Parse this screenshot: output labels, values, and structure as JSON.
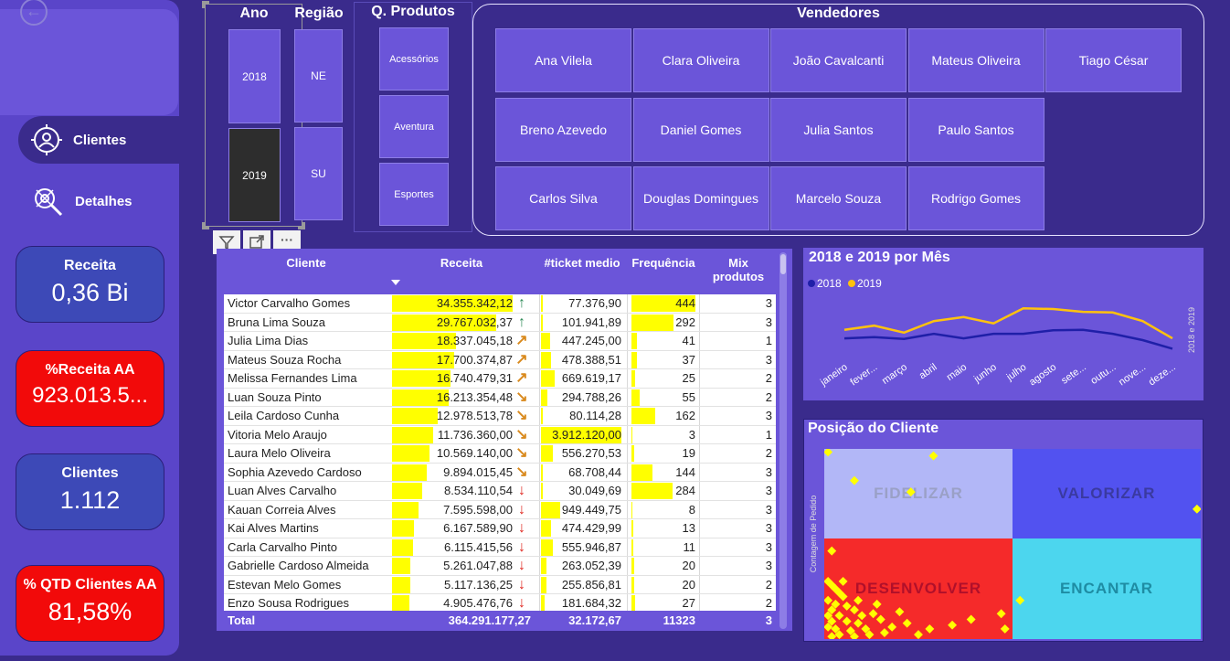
{
  "sidebar": {
    "back_icon": "back-arrow-icon",
    "nav": [
      {
        "label": "Clientes",
        "icon": "client-target-icon"
      },
      {
        "label": "Detalhes",
        "icon": "magnifier-target-icon"
      }
    ],
    "kpis": [
      {
        "title": "Receita",
        "value": "0,36 Bi"
      },
      {
        "title": "%Receita AA",
        "value": "923.013.5..."
      },
      {
        "title": "Clientes",
        "value": "1.112"
      },
      {
        "title": "% QTD Clientes AA",
        "value": "81,58%"
      }
    ]
  },
  "slicers": {
    "ano": {
      "title": "Ano",
      "options": [
        "2018",
        "2019"
      ],
      "selected": "2019"
    },
    "regiao": {
      "title": "Região",
      "options": [
        "NE",
        "SU"
      ]
    },
    "qprodutos": {
      "title": "Q. Produtos",
      "options": [
        "Acessórios",
        "Aventura",
        "Esportes"
      ]
    },
    "vendedores": {
      "title": "Vendedores",
      "options": [
        "Ana Vilela",
        "Clara Oliveira",
        "João Cavalcanti",
        "Mateus Oliveira",
        "Tiago César",
        "Breno Azevedo",
        "Daniel Gomes",
        "Julia Santos",
        "Paulo Santos",
        "Carlos Silva",
        "Douglas Domingues",
        "Marcelo Souza",
        "Rodrigo Gomes"
      ]
    }
  },
  "visual_icons": [
    "filter-icon",
    "focus-mode-icon",
    "more-options-icon"
  ],
  "table": {
    "headers": {
      "cliente": "Cliente",
      "receita": "Receita",
      "ticket": "#ticket medio",
      "freq": "Frequência",
      "mix": "Mix produtos"
    },
    "rows": [
      {
        "cliente": "Victor Carvalho Gomes",
        "receita": "34.355.342,12",
        "r": 34355342,
        "trend": "up",
        "ticket": "77.376,90",
        "t": 77377,
        "freq": "444",
        "f": 444,
        "mix": "3"
      },
      {
        "cliente": "Bruna Lima Souza",
        "receita": "29.767.032,37",
        "r": 29767032,
        "trend": "up",
        "ticket": "101.941,89",
        "t": 101942,
        "freq": "292",
        "f": 292,
        "mix": "3"
      },
      {
        "cliente": "Julia Lima Dias",
        "receita": "18.337.045,18",
        "r": 18337045,
        "trend": "diag-up",
        "ticket": "447.245,00",
        "t": 447245,
        "freq": "41",
        "f": 41,
        "mix": "1"
      },
      {
        "cliente": "Mateus Souza Rocha",
        "receita": "17.700.374,87",
        "r": 17700375,
        "trend": "diag-up",
        "ticket": "478.388,51",
        "t": 478389,
        "freq": "37",
        "f": 37,
        "mix": "3"
      },
      {
        "cliente": "Melissa Fernandes Lima",
        "receita": "16.740.479,31",
        "r": 16740479,
        "trend": "diag-up",
        "ticket": "669.619,17",
        "t": 669619,
        "freq": "25",
        "f": 25,
        "mix": "2"
      },
      {
        "cliente": "Luan Souza Pinto",
        "receita": "16.213.354,48",
        "r": 16213354,
        "trend": "diag-down",
        "ticket": "294.788,26",
        "t": 294788,
        "freq": "55",
        "f": 55,
        "mix": "2"
      },
      {
        "cliente": "Leila Cardoso Cunha",
        "receita": "12.978.513,78",
        "r": 12978514,
        "trend": "diag-down",
        "ticket": "80.114,28",
        "t": 80114,
        "freq": "162",
        "f": 162,
        "mix": "3"
      },
      {
        "cliente": "Vitoria Melo Araujo",
        "receita": "11.736.360,00",
        "r": 11736360,
        "trend": "diag-down",
        "ticket": "3.912.120,00",
        "t": 3912120,
        "freq": "3",
        "f": 3,
        "mix": "1"
      },
      {
        "cliente": "Laura Melo Oliveira",
        "receita": "10.569.140,00",
        "r": 10569140,
        "trend": "diag-down",
        "ticket": "556.270,53",
        "t": 556271,
        "freq": "19",
        "f": 19,
        "mix": "2"
      },
      {
        "cliente": "Sophia Azevedo Cardoso",
        "receita": "9.894.015,45",
        "r": 9894015,
        "trend": "diag-down",
        "ticket": "68.708,44",
        "t": 68708,
        "freq": "144",
        "f": 144,
        "mix": "3"
      },
      {
        "cliente": "Luan Alves Carvalho",
        "receita": "8.534.110,54",
        "r": 8534111,
        "trend": "down",
        "ticket": "30.049,69",
        "t": 30050,
        "freq": "284",
        "f": 284,
        "mix": "3"
      },
      {
        "cliente": "Kauan Correia Alves",
        "receita": "7.595.598,00",
        "r": 7595598,
        "trend": "down",
        "ticket": "949.449,75",
        "t": 949450,
        "freq": "8",
        "f": 8,
        "mix": "3"
      },
      {
        "cliente": "Kai Alves Martins",
        "receita": "6.167.589,90",
        "r": 6167590,
        "trend": "down",
        "ticket": "474.429,99",
        "t": 474430,
        "freq": "13",
        "f": 13,
        "mix": "3"
      },
      {
        "cliente": "Carla Carvalho Pinto",
        "receita": "6.115.415,56",
        "r": 6115416,
        "trend": "down",
        "ticket": "555.946,87",
        "t": 555947,
        "freq": "11",
        "f": 11,
        "mix": "3"
      },
      {
        "cliente": "Gabrielle Cardoso Almeida",
        "receita": "5.261.047,88",
        "r": 5261048,
        "trend": "down",
        "ticket": "263.052,39",
        "t": 263052,
        "freq": "20",
        "f": 20,
        "mix": "3"
      },
      {
        "cliente": "Estevan Melo Gomes",
        "receita": "5.117.136,25",
        "r": 5117136,
        "trend": "down",
        "ticket": "255.856,81",
        "t": 255857,
        "freq": "20",
        "f": 20,
        "mix": "2"
      },
      {
        "cliente": "Enzo Sousa Rodrigues",
        "receita": "4.905.476,76",
        "r": 4905477,
        "trend": "down",
        "ticket": "181.684,32",
        "t": 181684,
        "freq": "27",
        "f": 27,
        "mix": "2"
      }
    ],
    "total": {
      "label": "Total",
      "receita": "364.291.177,27",
      "ticket": "32.172,67",
      "freq": "11323",
      "mix": "3"
    }
  },
  "chart_data": [
    {
      "type": "line",
      "title": "2018 e 2019 por Mês",
      "ylabel": "2018 e 2019",
      "categories": [
        "janeiro",
        "fever...",
        "março",
        "abril",
        "maio",
        "junho",
        "julho",
        "agosto",
        "sete...",
        "outu...",
        "nove...",
        "deze..."
      ],
      "series": [
        {
          "name": "2018",
          "color": "#1f1fa8",
          "values": [
            0.3,
            0.32,
            0.29,
            0.38,
            0.3,
            0.38,
            0.38,
            0.44,
            0.45,
            0.38,
            0.27,
            0.12
          ]
        },
        {
          "name": "2019",
          "color": "#ffc20e",
          "values": [
            0.45,
            0.52,
            0.4,
            0.6,
            0.67,
            0.56,
            0.82,
            0.81,
            0.76,
            0.75,
            0.6,
            0.3
          ]
        }
      ],
      "ylim": [
        0,
        1
      ]
    },
    {
      "type": "scatter",
      "title": "Posição do Cliente",
      "ylabel": "Contagem de Pedido",
      "quadrants": [
        "FIDELIZAR",
        "VALORIZAR",
        "DESENVOLVER",
        "ENCANTAR"
      ],
      "quadrant_colors": [
        "#b2b7f7",
        "#5252f0",
        "#f52a2a",
        "#4cd6ee"
      ],
      "point_color": "#ffff00",
      "points": [
        [
          0.01,
          0.98
        ],
        [
          0.29,
          0.96
        ],
        [
          0.08,
          0.83
        ],
        [
          0.23,
          0.77
        ],
        [
          0.99,
          0.68
        ],
        [
          0.02,
          0.46
        ],
        [
          0.01,
          0.3
        ],
        [
          0.02,
          0.28
        ],
        [
          0.03,
          0.26
        ],
        [
          0.04,
          0.24
        ],
        [
          0.05,
          0.22
        ],
        [
          0.01,
          0.2
        ],
        [
          0.03,
          0.18
        ],
        [
          0.06,
          0.17
        ],
        [
          0.02,
          0.15
        ],
        [
          0.08,
          0.15
        ],
        [
          0.01,
          0.12
        ],
        [
          0.04,
          0.12
        ],
        [
          0.1,
          0.12
        ],
        [
          0.13,
          0.13
        ],
        [
          0.02,
          0.09
        ],
        [
          0.06,
          0.09
        ],
        [
          0.09,
          0.08
        ],
        [
          0.15,
          0.1
        ],
        [
          0.01,
          0.06
        ],
        [
          0.03,
          0.05
        ],
        [
          0.07,
          0.04
        ],
        [
          0.11,
          0.05
        ],
        [
          0.18,
          0.06
        ],
        [
          0.22,
          0.08
        ],
        [
          0.04,
          0.02
        ],
        [
          0.12,
          0.02
        ],
        [
          0.16,
          0.03
        ],
        [
          0.28,
          0.05
        ],
        [
          0.34,
          0.07
        ],
        [
          0.39,
          0.1
        ],
        [
          0.47,
          0.13
        ],
        [
          0.52,
          0.2
        ],
        [
          0.48,
          0.05
        ],
        [
          0.02,
          0.01
        ],
        [
          0.08,
          0.01
        ],
        [
          0.25,
          0.02
        ],
        [
          0.05,
          0.3
        ],
        [
          0.09,
          0.2
        ],
        [
          0.14,
          0.18
        ],
        [
          0.2,
          0.14
        ]
      ]
    }
  ]
}
